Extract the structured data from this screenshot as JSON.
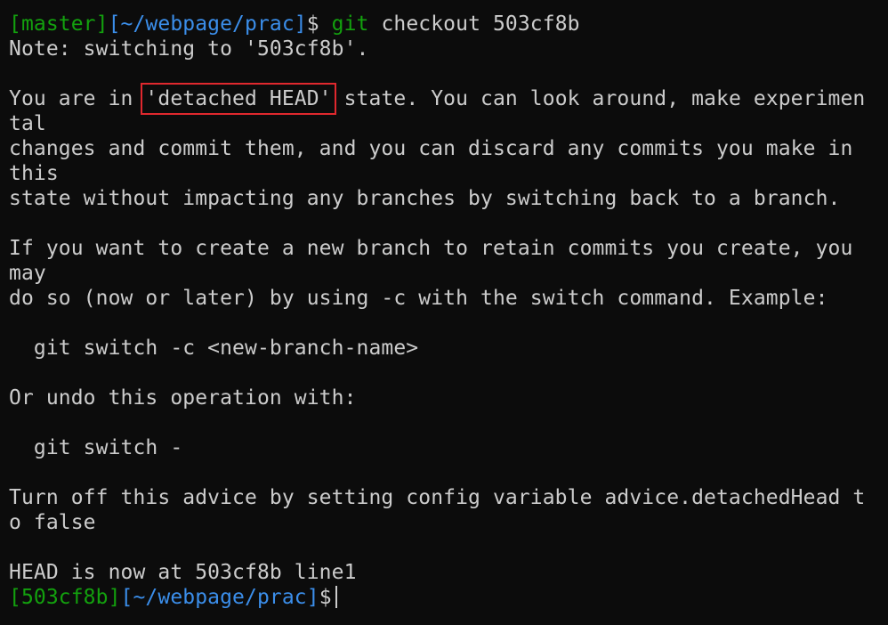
{
  "prompt1": {
    "branch": "[master]",
    "path": "[~/webpage/prac]",
    "symbol": "$",
    "git": "git",
    "args": "checkout 503cf8b"
  },
  "output": {
    "note": "Note: switching to '503cf8b'.",
    "detached_pre": "You are in ",
    "detached_highlight": "'detached HEAD'",
    "detached_post": " state. You can look around, make experimen",
    "line_tal": "tal",
    "line_changes": "changes and commit them, and you can discard any commits you make in",
    "line_this": "this",
    "line_state": "state without impacting any branches by switching back to a branch.",
    "line_if": "If you want to create a new branch to retain commits you create, you",
    "line_may": "may",
    "line_doso": "do so (now or later) by using -c with the switch command. Example:",
    "line_switch_c": "  git switch -c <new-branch-name>",
    "line_undo": "Or undo this operation with:",
    "line_switch_dash": "  git switch -",
    "line_turnoff": "Turn off this advice by setting config variable advice.detachedHead t",
    "line_ofalse": "o false",
    "line_head": "HEAD is now at 503cf8b line1"
  },
  "prompt2": {
    "branch": "[503cf8b]",
    "path": "[~/webpage/prac]",
    "symbol": "$"
  },
  "colors": {
    "background": "#0c0c0c",
    "text": "#cccccc",
    "green": "#13a10e",
    "blue": "#3b8eea",
    "highlight_border": "#e0282e"
  }
}
